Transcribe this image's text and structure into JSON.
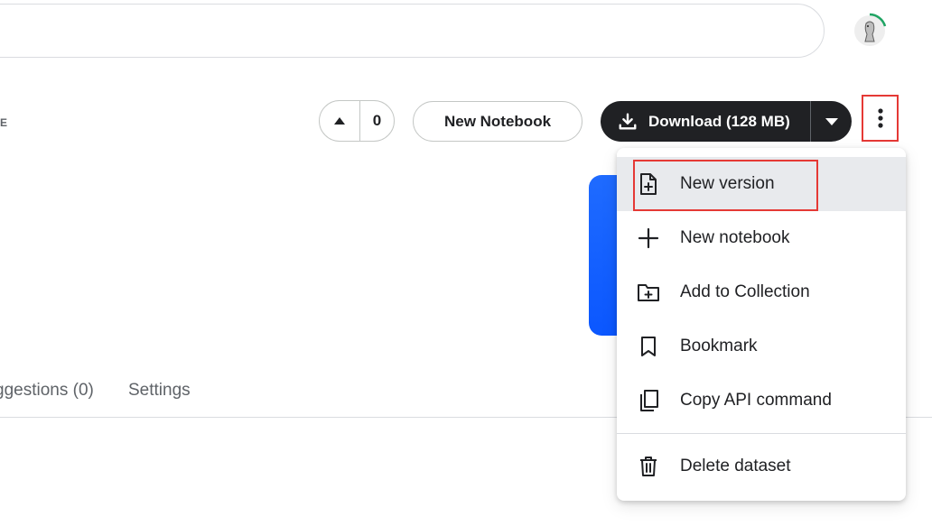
{
  "header": {
    "search": {
      "placeholder": ""
    }
  },
  "dataset": {
    "subtitle_fragment": "E"
  },
  "actions": {
    "upvote_count": "0",
    "new_notebook_label": "New Notebook",
    "download_label": "Download (128 MB)"
  },
  "tabs": [
    {
      "label": "ggestions (0)"
    },
    {
      "label": "Settings"
    }
  ],
  "menu": {
    "items": [
      {
        "label": "New version",
        "icon": "file-plus-icon"
      },
      {
        "label": "New notebook",
        "icon": "plus-icon"
      },
      {
        "label": "Add to Collection",
        "icon": "folder-plus-icon"
      },
      {
        "label": "Bookmark",
        "icon": "bookmark-icon"
      },
      {
        "label": "Copy API command",
        "icon": "copy-icon"
      },
      {
        "label": "Delete dataset",
        "icon": "trash-icon"
      }
    ]
  },
  "colors": {
    "primary_dark": "#202124",
    "highlight_red": "#e53935",
    "banner_blue": "#1f6bff",
    "progress_green": "#20a464"
  }
}
